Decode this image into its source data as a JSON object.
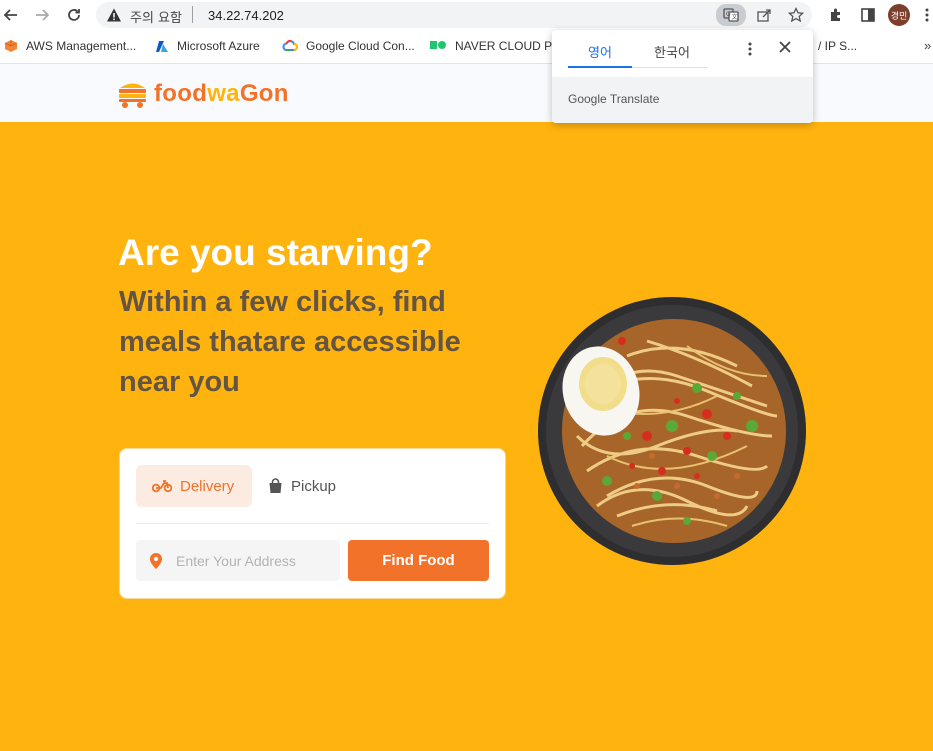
{
  "browser": {
    "security_text": "주의 요함",
    "url": "34.22.74.202",
    "profile_initials": "경민",
    "bookmarks": [
      {
        "label": "AWS Management...",
        "icon": "aws-icon"
      },
      {
        "label": "Microsoft Azure",
        "icon": "azure-icon"
      },
      {
        "label": "Google Cloud Con...",
        "icon": "google-cloud-icon"
      },
      {
        "label": "NAVER CLOUD PL",
        "icon": "naver-cloud-icon"
      },
      {
        "label": "/ IP S...",
        "icon": "bookmark-icon"
      }
    ],
    "more_bookmarks": "»"
  },
  "translate_popup": {
    "tab_source": "영어",
    "tab_target": "한국어",
    "brand": "Google Translate"
  },
  "site": {
    "logo_part1": "food",
    "logo_part2": "wa",
    "logo_part3": "Gon",
    "headline": "Are you starving?",
    "subheadline": "Within a few clicks, find meals thatare accessible near you",
    "tabs": [
      {
        "label": "Delivery",
        "active": true
      },
      {
        "label": "Pickup",
        "active": false
      }
    ],
    "address_placeholder": "Enter Your Address",
    "find_button": "Find Food"
  },
  "colors": {
    "accent_orange": "#F17228",
    "hero_yellow": "#FFB30E",
    "heading_dark": "#5C4F45"
  }
}
